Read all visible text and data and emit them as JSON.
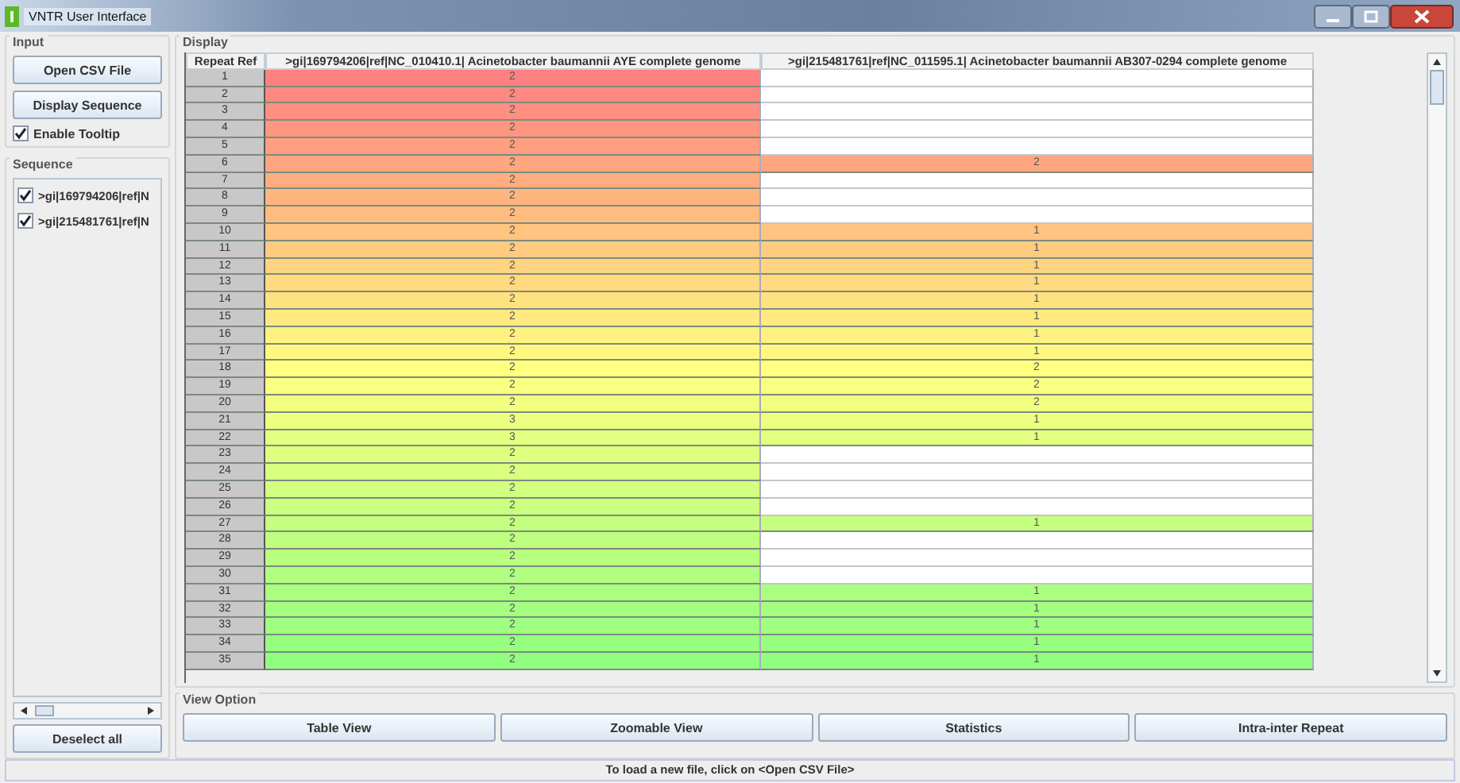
{
  "window": {
    "title": "VNTR User Interface"
  },
  "input": {
    "title": "Input",
    "buttons": [
      "Open CSV File",
      "Display Sequence"
    ],
    "tooltip": {
      "label": "Enable Tooltip",
      "checked": true
    }
  },
  "sequence": {
    "title": "Sequence",
    "items": [
      {
        "label": ">gi|169794206|ref|N",
        "checked": true
      },
      {
        "label": ">gi|215481761|ref|N",
        "checked": true
      }
    ],
    "deselect_button": "Deselect all"
  },
  "display": {
    "title": "Display",
    "table": {
      "columns": [
        "Repeat Ref",
        ">gi|169794206|ref|NC_010410.1| Acinetobacter baumannii AYE complete genome",
        ">gi|215481761|ref|NC_011595.1| Acinetobacter baumannii AB307-0294 complete genome"
      ],
      "rows": [
        {
          "cells": [
            "1",
            "2",
            ""
          ],
          "color": "#ff8080"
        },
        {
          "cells": [
            "2",
            "2",
            ""
          ],
          "color": "#ff8880"
        },
        {
          "cells": [
            "3",
            "2",
            ""
          ],
          "color": "#ff8f80"
        },
        {
          "cells": [
            "4",
            "2",
            ""
          ],
          "color": "#ff9780"
        },
        {
          "cells": [
            "5",
            "2",
            ""
          ],
          "color": "#ff9e80"
        },
        {
          "cells": [
            "6",
            "2",
            "2"
          ],
          "color": "#ffa680"
        },
        {
          "cells": [
            "7",
            "2",
            ""
          ],
          "color": "#ffad80"
        },
        {
          "cells": [
            "8",
            "2",
            ""
          ],
          "color": "#ffb580"
        },
        {
          "cells": [
            "9",
            "2",
            ""
          ],
          "color": "#ffbc80"
        },
        {
          "cells": [
            "10",
            "2",
            "1"
          ],
          "color": "#ffc480"
        },
        {
          "cells": [
            "11",
            "2",
            "1"
          ],
          "color": "#ffcb80"
        },
        {
          "cells": [
            "12",
            "2",
            "1"
          ],
          "color": "#ffd380"
        },
        {
          "cells": [
            "13",
            "2",
            "1"
          ],
          "color": "#ffda80"
        },
        {
          "cells": [
            "14",
            "2",
            "1"
          ],
          "color": "#ffe280"
        },
        {
          "cells": [
            "15",
            "2",
            "1"
          ],
          "color": "#ffe980"
        },
        {
          "cells": [
            "16",
            "2",
            "1"
          ],
          "color": "#fff180"
        },
        {
          "cells": [
            "17",
            "2",
            "1"
          ],
          "color": "#fff880"
        },
        {
          "cells": [
            "18",
            "2",
            "2"
          ],
          "color": "#ffff80"
        },
        {
          "cells": [
            "19",
            "2",
            "2"
          ],
          "color": "#f9ff80"
        },
        {
          "cells": [
            "20",
            "2",
            "2"
          ],
          "color": "#f2ff80"
        },
        {
          "cells": [
            "21",
            "3",
            "1"
          ],
          "color": "#ecff80"
        },
        {
          "cells": [
            "22",
            "3",
            "1"
          ],
          "color": "#e5ff80"
        },
        {
          "cells": [
            "23",
            "2",
            ""
          ],
          "color": "#dfff80"
        },
        {
          "cells": [
            "24",
            "2",
            ""
          ],
          "color": "#d8ff80"
        },
        {
          "cells": [
            "25",
            "2",
            ""
          ],
          "color": "#d2ff80"
        },
        {
          "cells": [
            "26",
            "2",
            ""
          ],
          "color": "#cbff80"
        },
        {
          "cells": [
            "27",
            "2",
            "1"
          ],
          "color": "#c5ff80"
        },
        {
          "cells": [
            "28",
            "2",
            ""
          ],
          "color": "#beff80"
        },
        {
          "cells": [
            "29",
            "2",
            ""
          ],
          "color": "#b8ff80"
        },
        {
          "cells": [
            "30",
            "2",
            ""
          ],
          "color": "#b1ff80"
        },
        {
          "cells": [
            "31",
            "2",
            "1"
          ],
          "color": "#abff80"
        },
        {
          "cells": [
            "32",
            "2",
            "1"
          ],
          "color": "#a4ff80"
        },
        {
          "cells": [
            "33",
            "2",
            "1"
          ],
          "color": "#9eff80"
        },
        {
          "cells": [
            "34",
            "2",
            "1"
          ],
          "color": "#97ff80"
        },
        {
          "cells": [
            "35",
            "2",
            "1"
          ],
          "color": "#90ff80"
        }
      ]
    }
  },
  "view_option": {
    "title": "View Option",
    "buttons": [
      "Table View",
      "Zoomable View",
      "Statistics",
      "Intra-inter Repeat"
    ]
  },
  "status_bar": "To load a new file, click on <Open CSV File>"
}
